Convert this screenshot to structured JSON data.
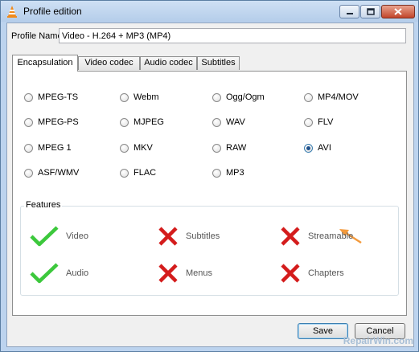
{
  "window": {
    "title": "Profile edition",
    "minimize_icon": "minimize-icon",
    "maximize_icon": "maximize-icon",
    "close_icon": "close-icon"
  },
  "profile": {
    "name_label": "Profile Name",
    "name_value": "Video - H.264 + MP3 (MP4)"
  },
  "tabs": [
    {
      "label": "Encapsulation",
      "active": true
    },
    {
      "label": "Video codec",
      "active": false
    },
    {
      "label": "Audio codec",
      "active": false
    },
    {
      "label": "Subtitles",
      "active": false
    }
  ],
  "formats": [
    {
      "label": "MPEG-TS",
      "checked": false
    },
    {
      "label": "Webm",
      "checked": false
    },
    {
      "label": "Ogg/Ogm",
      "checked": false
    },
    {
      "label": "MP4/MOV",
      "checked": false
    },
    {
      "label": "MPEG-PS",
      "checked": false
    },
    {
      "label": "MJPEG",
      "checked": false
    },
    {
      "label": "WAV",
      "checked": false
    },
    {
      "label": "FLV",
      "checked": false
    },
    {
      "label": "MPEG 1",
      "checked": false
    },
    {
      "label": "MKV",
      "checked": false
    },
    {
      "label": "RAW",
      "checked": false
    },
    {
      "label": "AVI",
      "checked": true
    },
    {
      "label": "ASF/WMV",
      "checked": false
    },
    {
      "label": "FLAC",
      "checked": false
    },
    {
      "label": "MP3",
      "checked": false
    }
  ],
  "features": {
    "title": "Features",
    "items": [
      {
        "label": "Video",
        "supported": true
      },
      {
        "label": "Subtitles",
        "supported": false
      },
      {
        "label": "Streamable",
        "supported": false
      },
      {
        "label": "Audio",
        "supported": true
      },
      {
        "label": "Menus",
        "supported": false
      },
      {
        "label": "Chapters",
        "supported": false
      }
    ]
  },
  "buttons": {
    "save": "Save",
    "cancel": "Cancel"
  },
  "watermark": "RepairWin.com",
  "colors": {
    "check": "#3cc83c",
    "cross": "#d41c1c",
    "arrow": "#f39a3c"
  }
}
